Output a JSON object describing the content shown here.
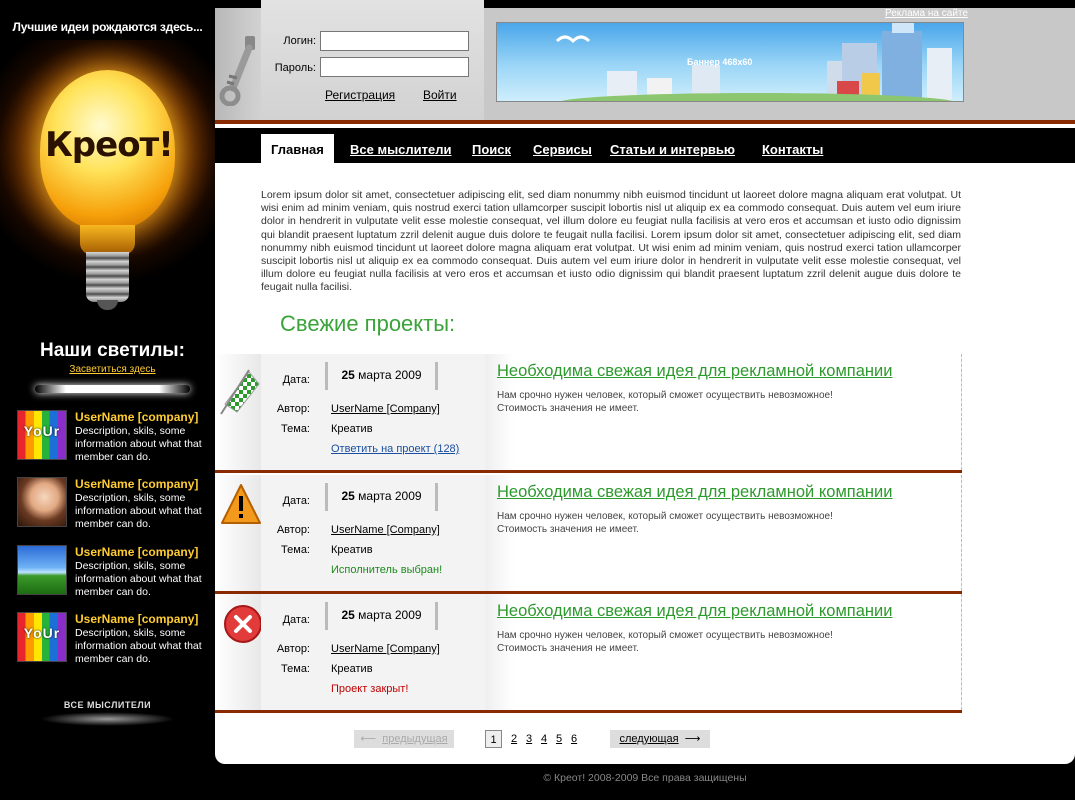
{
  "sidebar": {
    "tagline": "Лучшие идеи рождаются здесь...",
    "logo": "Креот!",
    "stars_title": "Наши светилы:",
    "stars_link": "Засветиться здесь",
    "members": [
      {
        "name": "UserName [company]",
        "desc": "Description, skils, some information about what that member can do.",
        "avatar": "yourstyle",
        "avatar_text": "YoUr"
      },
      {
        "name": "UserName [company]",
        "desc": "Description, skils, some information about what that member can do.",
        "avatar": "girl-photo"
      },
      {
        "name": "UserName [company]",
        "desc": "Description, skils, some information about what that member can do.",
        "avatar": "field-photo"
      },
      {
        "name": "UserName [company]",
        "desc": "Description, skils, some information about what that member can do.",
        "avatar": "yourstyle",
        "avatar_text": "YoUr"
      }
    ],
    "all_thinkers": "ВСЕ МЫСЛИТЕЛИ"
  },
  "login": {
    "login_label": "Логин:",
    "password_label": "Пароль:",
    "login_value": "",
    "password_value": "",
    "register": "Регистрация",
    "signin": "Войти"
  },
  "banner": {
    "ad_link": "Реклама на сайте",
    "text": "Баннер 468x60"
  },
  "nav": [
    {
      "label": "Главная",
      "active": true
    },
    {
      "label": "Все мыслители"
    },
    {
      "label": "Поиск"
    },
    {
      "label": "Сервисы"
    },
    {
      "label": "Статьи и интервью"
    },
    {
      "label": "Контакты"
    }
  ],
  "intro": "Lorem ipsum dolor sit amet, consectetuer adipiscing elit, sed diam nonummy nibh euismod tincidunt ut laoreet dolore magna aliquam erat volutpat. Ut wisi enim ad minim veniam, quis nostrud exerci tation ullamcorper suscipit lobortis nisl ut aliquip ex ea commodo consequat. Duis autem vel eum iriure dolor in hendrerit in vulputate velit esse molestie consequat, vel illum dolore eu feugiat nulla facilisis at vero eros et accumsan et iusto odio dignissim qui blandit praesent luptatum zzril delenit augue duis dolore te feugait nulla facilisi. Lorem ipsum dolor sit amet, consectetuer adipiscing elit, sed diam nonummy nibh euismod tincidunt ut laoreet dolore magna aliquam erat volutpat. Ut wisi enim ad minim veniam, quis nostrud exerci tation ullamcorper suscipit lobortis nisl ut aliquip ex ea commodo consequat. Duis autem vel eum iriure dolor in hendrerit in vulputate velit esse molestie consequat, vel illum dolore eu feugiat nulla facilisis at vero eros et accumsan et iusto odio dignissim qui blandit praesent luptatum zzril delenit augue duis dolore te feugait nulla facilisi.",
  "projects_title": "Свежие проекты:",
  "labels": {
    "date": "Дата:",
    "author": "Автор:",
    "topic": "Тема:"
  },
  "projects": [
    {
      "icon": "checkered-flag-icon",
      "day": "25",
      "month_year": "марта 2009",
      "author": "UserName [Company]",
      "topic": "Креатив",
      "status": "Ответить на проект (128)",
      "status_type": "reply",
      "title": "Необходима свежая идея для рекламной компании",
      "desc1": "Нам срочно нужен человек, который сможет осуществить невозможное!",
      "desc2": "Стоимость значения не имеет."
    },
    {
      "icon": "warning-icon",
      "day": "25",
      "month_year": "марта 2009",
      "author": "UserName [Company]",
      "topic": "Креатив",
      "status": "Исполнитель выбран!",
      "status_type": "chosen",
      "title": "Необходима свежая идея для рекламной компании",
      "desc1": "Нам срочно нужен человек, который сможет осуществить невозможное!",
      "desc2": "Стоимость значения не имеет."
    },
    {
      "icon": "error-icon",
      "day": "25",
      "month_year": "марта 2009",
      "author": "UserName [Company]",
      "topic": "Креатив",
      "status": "Проект закрыт!",
      "status_type": "closed",
      "title": "Необходима свежая идея для рекламной компании",
      "desc1": "Нам срочно нужен человек, который сможет осуществить невозможное!",
      "desc2": "Стоимость значения не имеет."
    }
  ],
  "pager": {
    "prev": "предыдущая",
    "next": "следующая",
    "pages": [
      "1",
      "2",
      "3",
      "4",
      "5",
      "6"
    ],
    "current": "1"
  },
  "footer": "© Креот! 2008-2009   Все права защищены",
  "colors": {
    "accent_green": "#3aa33a",
    "divider_brown": "#8a2a00",
    "sidebar_yellow": "#ffcc33"
  }
}
